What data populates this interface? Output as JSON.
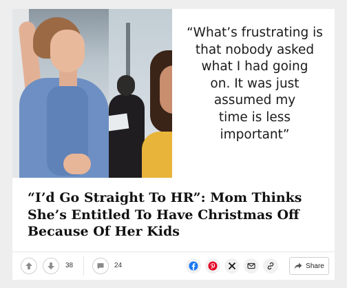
{
  "post": {
    "quote_lines": [
      "“What’s frustrating is",
      "that nobody asked",
      "what I had going",
      "on. It was just",
      "assumed my",
      "time is less",
      "important”"
    ],
    "title_lines": [
      "“I’d Go Straight To HR”: Mom Thinks",
      "She’s Entitled To Have Christmas Off",
      "Because Of Her Kids"
    ],
    "votes": "38",
    "comments": "24",
    "share_label": "Share"
  },
  "icons": {
    "upvote": "arrow-up-icon",
    "downvote": "arrow-down-icon",
    "comment": "comment-icon",
    "facebook": "facebook-icon",
    "pinterest": "pinterest-icon",
    "x": "x-icon",
    "email": "mail-icon",
    "link": "link-icon",
    "share": "share-arrow-icon"
  },
  "colors": {
    "facebook": "#1877f2",
    "pinterest": "#e60023",
    "text": "#111111",
    "icon_gray": "#8a8a8a"
  }
}
